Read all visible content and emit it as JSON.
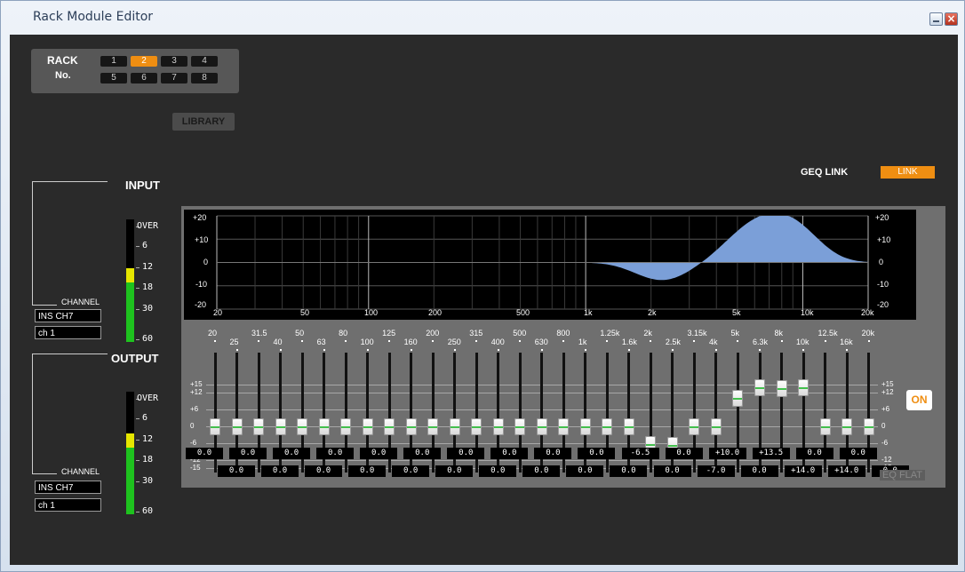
{
  "window": {
    "title": "Rack Module Editor",
    "close_icon": "×"
  },
  "rack": {
    "label1": "RACK",
    "label2": "No.",
    "buttons": [
      "1",
      "2",
      "3",
      "4",
      "5",
      "6",
      "7",
      "8"
    ],
    "selected": "2"
  },
  "library_label": "LIBRARY",
  "input": {
    "heading": "INPUT",
    "channel_label": "CHANNEL",
    "channel": "INS CH7",
    "source": "ch 1",
    "meter_labels": [
      "OVER",
      "6",
      "12",
      "18",
      "30",
      "60"
    ]
  },
  "output": {
    "heading": "OUTPUT",
    "channel_label": "CHANNEL",
    "channel": "INS CH7",
    "source": "ch 1",
    "meter_labels": [
      "OVER",
      "6",
      "12",
      "18",
      "30",
      "60"
    ]
  },
  "geq_link": {
    "label": "GEQ LINK",
    "button": "LINK"
  },
  "graph": {
    "db_labels": [
      "+20",
      "+10",
      "0",
      "-10",
      "-20"
    ],
    "freq_labels": [
      "20",
      "50",
      "100",
      "200",
      "500",
      "1k",
      "2k",
      "5k",
      "10k",
      "20k"
    ]
  },
  "bands": {
    "freqs": [
      "20",
      "25",
      "31.5",
      "40",
      "50",
      "63",
      "80",
      "100",
      "125",
      "160",
      "200",
      "250",
      "315",
      "400",
      "500",
      "630",
      "800",
      "1k",
      "1.25k",
      "1.6k",
      "2k",
      "2.5k",
      "3.15k",
      "4k",
      "5k",
      "6.3k",
      "8k",
      "10k",
      "12.5k",
      "16k",
      "20k"
    ],
    "gains": [
      0,
      0,
      0,
      0,
      0,
      0,
      0,
      0,
      0,
      0,
      0,
      0,
      0,
      0,
      0,
      0,
      0,
      0,
      0,
      0,
      -6.5,
      -7,
      0,
      0,
      10,
      14,
      13.5,
      14,
      0,
      0,
      0
    ],
    "values_top": [
      "0.0",
      "0.0",
      "0.0",
      "0.0",
      "0.0",
      "0.0",
      "0.0",
      "0.0",
      "0.0",
      "0.0",
      "-6.5",
      "0.0",
      "+10.0",
      "+13.5",
      "0.0",
      "0.0"
    ],
    "values_bottom": [
      "0.0",
      "0.0",
      "0.0",
      "0.0",
      "0.0",
      "0.0",
      "0.0",
      "0.0",
      "0.0",
      "0.0",
      "0.0",
      "-7.0",
      "0.0",
      "+14.0",
      "+14.0",
      "0.0"
    ],
    "scale_labels": [
      "+15",
      "+12",
      "+6",
      "0",
      "-6",
      "-12",
      "-15"
    ]
  },
  "on_button": "ON",
  "eq_flat": "EQ FLAT",
  "colors": {
    "accent": "#ef8e12",
    "curve": "#7b9fd8",
    "meter_green": "#1ec21e",
    "meter_yellow": "#e6e600"
  }
}
